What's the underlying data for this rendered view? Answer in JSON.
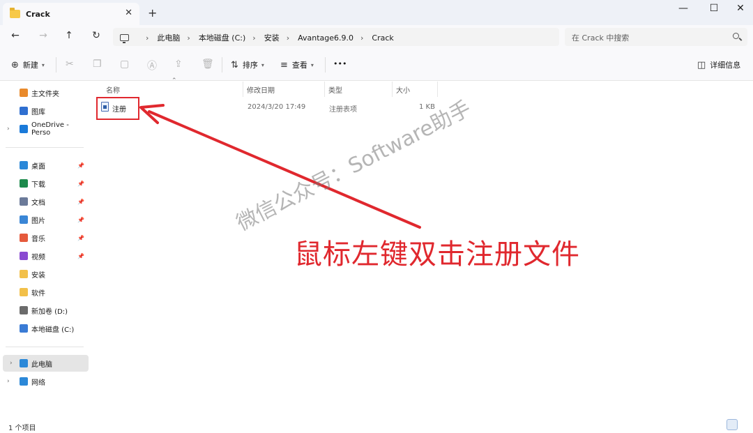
{
  "window": {
    "tab_title": "Crack",
    "tab_close_glyph": "✕",
    "new_tab_glyph": "+",
    "minimize_glyph": "—",
    "maximize_glyph": "☐",
    "close_glyph": "✕"
  },
  "address": {
    "breadcrumbs": [
      "此电脑",
      "本地磁盘 (C:)",
      "安装",
      "Avantage6.9.0",
      "Crack"
    ],
    "search_placeholder": "在 Crack 中搜索"
  },
  "toolbar": {
    "new_label": "新建",
    "sort_label": "排序",
    "view_label": "查看",
    "more_label": "•••",
    "details_label": "详细信息"
  },
  "sidebar": {
    "quick": [
      {
        "label": "主文件夹",
        "icon": "home-icon",
        "color": "#e98a2c"
      },
      {
        "label": "图库",
        "icon": "gallery-icon",
        "color": "#2f6fd0"
      },
      {
        "label": "OneDrive - Perso",
        "icon": "onedrive-icon",
        "color": "#1a7ad9"
      }
    ],
    "pinned": [
      {
        "label": "桌面",
        "icon": "desktop-icon",
        "color": "#2b88d8",
        "pinned": true
      },
      {
        "label": "下载",
        "icon": "download-icon",
        "color": "#1d8a4c",
        "pinned": true
      },
      {
        "label": "文档",
        "icon": "documents-icon",
        "color": "#6b7a99",
        "pinned": true
      },
      {
        "label": "图片",
        "icon": "pictures-icon",
        "color": "#3a86d6",
        "pinned": true
      },
      {
        "label": "音乐",
        "icon": "music-icon",
        "color": "#e55a3c",
        "pinned": true
      },
      {
        "label": "视频",
        "icon": "videos-icon",
        "color": "#8a4ad1",
        "pinned": true
      },
      {
        "label": "安装",
        "icon": "folder-icon",
        "color": "#f2c04a",
        "pinned": false
      },
      {
        "label": "软件",
        "icon": "folder-icon",
        "color": "#f2c04a",
        "pinned": false
      },
      {
        "label": "新加卷 (D:)",
        "icon": "drive-icon",
        "color": "#6b6b6b",
        "pinned": false
      },
      {
        "label": "本地磁盘 (C:)",
        "icon": "drive-icon",
        "color": "#3a7bd5",
        "pinned": false
      }
    ],
    "devices": [
      {
        "label": "此电脑",
        "icon": "this-pc-icon",
        "color": "#2b88d8"
      },
      {
        "label": "网络",
        "icon": "network-icon",
        "color": "#2b88d8"
      }
    ]
  },
  "columns": {
    "name": "名称",
    "modified": "修改日期",
    "type": "类型",
    "size": "大小"
  },
  "files": [
    {
      "name": "注册",
      "modified": "2024/3/20 17:49",
      "type": "注册表项",
      "size": "1 KB"
    }
  ],
  "status": {
    "item_count": "1 个项目"
  },
  "annotation": {
    "instruction": "鼠标左键双击注册文件",
    "watermark": "微信公众号：Software助手",
    "accent_color": "#e0282e"
  }
}
